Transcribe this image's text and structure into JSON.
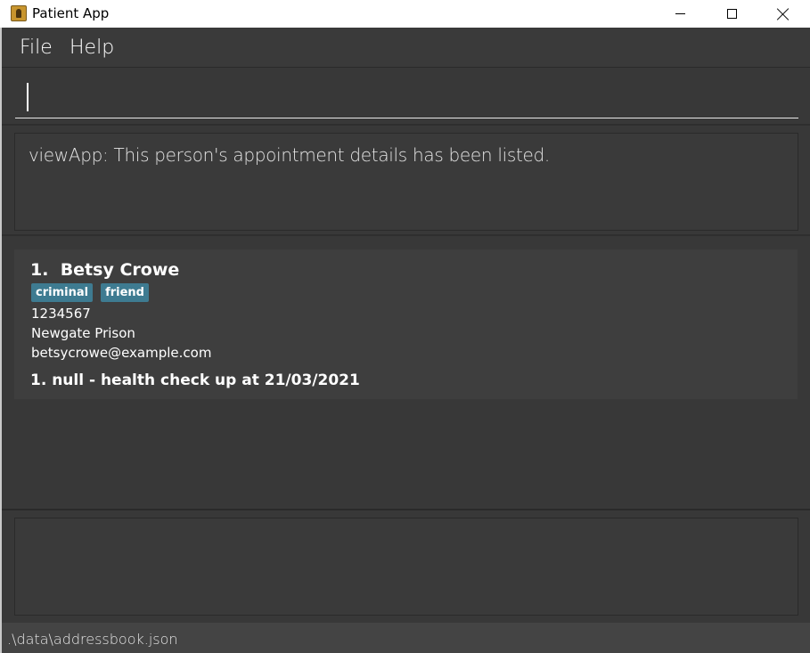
{
  "window": {
    "title": "Patient App",
    "icon": "app-icon",
    "controls": [
      "minimize-icon",
      "maximize-icon",
      "close-icon"
    ]
  },
  "menu": {
    "file_label": "File",
    "help_label": "Help"
  },
  "command": {
    "value": "",
    "placeholder": ""
  },
  "result": {
    "message": "viewApp: This person's appointment details has been listed."
  },
  "persons": [
    {
      "index": "1.",
      "name": "Betsy Crowe",
      "tags": [
        "criminal",
        "friend"
      ],
      "phone": "1234567",
      "address": "Newgate Prison",
      "email": "betsycrowe@example.com",
      "appointment": "1. null - health check up at 21/03/2021"
    }
  ],
  "status": {
    "file_path": ".\\data\\addressbook.json"
  },
  "colors": {
    "background": "#383838",
    "card": "#3e3e3e",
    "tag": "#3e7b91",
    "text": "#ffffff"
  }
}
